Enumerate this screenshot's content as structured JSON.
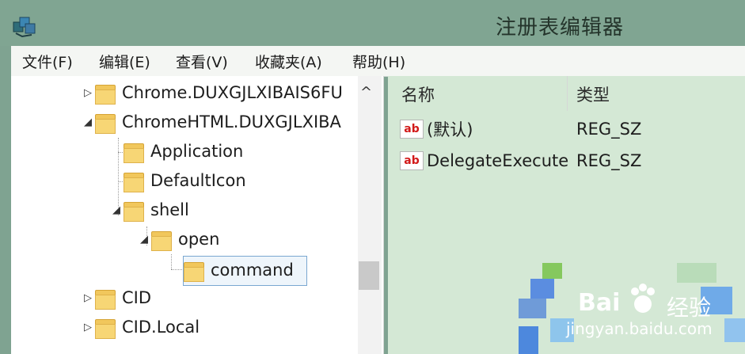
{
  "window": {
    "title": "注册表编辑器"
  },
  "menu": [
    {
      "label": "文件(F)"
    },
    {
      "label": "编辑(E)"
    },
    {
      "label": "查看(V)"
    },
    {
      "label": "收藏夹(A)"
    },
    {
      "label": "帮助(H)"
    }
  ],
  "tree": {
    "rows": [
      {
        "label": "Chrome.DUXGJLXIBAIS6FU",
        "expander": "▷",
        "expanded": false
      },
      {
        "label": "ChromeHTML.DUXGJLXIBA",
        "expander": "◢",
        "expanded": true
      },
      {
        "label": "Application",
        "expander": "",
        "expanded": false
      },
      {
        "label": "DefaultIcon",
        "expander": "",
        "expanded": false
      },
      {
        "label": "shell",
        "expander": "◢",
        "expanded": true
      },
      {
        "label": "open",
        "expander": "◢",
        "expanded": true
      },
      {
        "label": "command",
        "expander": "",
        "expanded": false,
        "selected": true
      },
      {
        "label": "CID",
        "expander": "▷",
        "expanded": false
      },
      {
        "label": "CID.Local",
        "expander": "▷",
        "expanded": false
      }
    ],
    "scroll_up_glyph": "^"
  },
  "list": {
    "headers": {
      "name": "名称",
      "type": "类型"
    },
    "rows": [
      {
        "icon": "ab",
        "name": "(默认)",
        "type": "REG_SZ"
      },
      {
        "icon": "ab",
        "name": "DelegateExecute",
        "type": "REG_SZ"
      }
    ]
  },
  "watermark": {
    "logo": "Bai",
    "logo_icon": "paw-icon",
    "logo_suffix": "经验",
    "url": "jingyan.baidu.com"
  },
  "colors": {
    "title_bar": "#80a592",
    "right_pane": "#d4e8d5",
    "folder": "#f1c75c",
    "selection_border": "#7aa7d1"
  }
}
